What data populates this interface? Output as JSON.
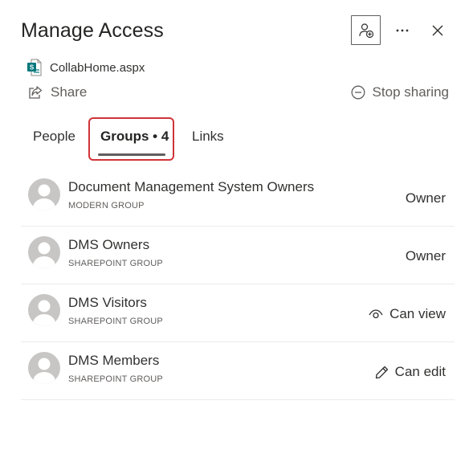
{
  "header": {
    "title": "Manage Access",
    "grant_icon": "person-add-icon",
    "more_icon": "more-horizontal-icon",
    "close_icon": "close-icon"
  },
  "file": {
    "name": "CollabHome.aspx",
    "icon": "sharepoint-page-icon"
  },
  "actions": {
    "share_label": "Share",
    "stop_sharing_label": "Stop sharing"
  },
  "tabs": {
    "people": "People",
    "groups": "Groups • 4",
    "links": "Links",
    "selected": "groups"
  },
  "groups": [
    {
      "name": "Document Management System Owners",
      "type": "MODERN GROUP",
      "role": "Owner",
      "role_icon": ""
    },
    {
      "name": "DMS Owners",
      "type": "SHAREPOINT GROUP",
      "role": "Owner",
      "role_icon": ""
    },
    {
      "name": "DMS Visitors",
      "type": "SHAREPOINT GROUP",
      "role": "Can view",
      "role_icon": "eye-icon"
    },
    {
      "name": "DMS Members",
      "type": "SHAREPOINT GROUP",
      "role": "Can edit",
      "role_icon": "pencil-icon"
    }
  ],
  "colors": {
    "highlight_border": "#d13438",
    "tab_underline": "#605e5c",
    "sharepoint_teal": "#03787c",
    "avatar_bg": "#c8c6c4"
  }
}
